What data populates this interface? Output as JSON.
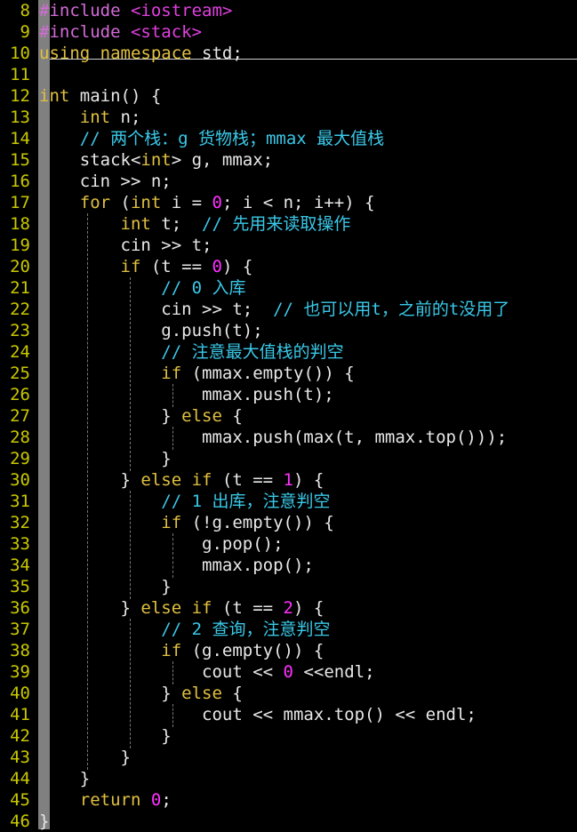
{
  "editor": {
    "line_numbers": [
      "8",
      "9",
      "10",
      "11",
      "12",
      "13",
      "14",
      "15",
      "16",
      "17",
      "18",
      "19",
      "20",
      "21",
      "22",
      "23",
      "24",
      "25",
      "26",
      "27",
      "28",
      "29",
      "30",
      "31",
      "32",
      "33",
      "34",
      "35",
      "36",
      "37",
      "38",
      "39",
      "40",
      "41",
      "42",
      "43",
      "44",
      "45",
      "46"
    ],
    "lines": [
      [
        [
          "pp",
          "#include "
        ],
        [
          "str",
          "<iostream>"
        ]
      ],
      [
        [
          "pp",
          "#include "
        ],
        [
          "str",
          "<stack>"
        ]
      ],
      [
        [
          "kw",
          "using namespace "
        ],
        [
          "tx",
          "std;"
        ]
      ],
      [],
      [
        [
          "kw",
          "int"
        ],
        [
          "tx",
          " main() {"
        ]
      ],
      [
        [
          "tx",
          "    "
        ],
        [
          "kw",
          "int"
        ],
        [
          "tx",
          " n;"
        ]
      ],
      [
        [
          "tx",
          "    "
        ],
        [
          "cm",
          "// 两个栈：g 货物栈；mmax 最大值栈"
        ]
      ],
      [
        [
          "tx",
          "    stack<"
        ],
        [
          "kw",
          "int"
        ],
        [
          "tx",
          "> g, mmax;"
        ]
      ],
      [
        [
          "tx",
          "    cin >> n;"
        ]
      ],
      [
        [
          "tx",
          "    "
        ],
        [
          "kw",
          "for"
        ],
        [
          "tx",
          " ("
        ],
        [
          "kw",
          "int"
        ],
        [
          "tx",
          " i = "
        ],
        [
          "num",
          "0"
        ],
        [
          "tx",
          "; i < n; i++) {"
        ]
      ],
      [
        [
          "tx",
          "        "
        ],
        [
          "kw",
          "int"
        ],
        [
          "tx",
          " t;  "
        ],
        [
          "cm",
          "// 先用来读取操作"
        ]
      ],
      [
        [
          "tx",
          "        cin >> t;"
        ]
      ],
      [
        [
          "tx",
          "        "
        ],
        [
          "kw",
          "if"
        ],
        [
          "tx",
          " (t == "
        ],
        [
          "num",
          "0"
        ],
        [
          "tx",
          ") {"
        ]
      ],
      [
        [
          "tx",
          "            "
        ],
        [
          "cm",
          "// 0 入库"
        ]
      ],
      [
        [
          "tx",
          "            cin >> t;  "
        ],
        [
          "cm",
          "// 也可以用t，之前的t没用了"
        ]
      ],
      [
        [
          "tx",
          "            g.push(t);"
        ]
      ],
      [
        [
          "tx",
          "            "
        ],
        [
          "cm",
          "// 注意最大值栈的判空"
        ]
      ],
      [
        [
          "tx",
          "            "
        ],
        [
          "kw",
          "if"
        ],
        [
          "tx",
          " (mmax.empty()) {"
        ]
      ],
      [
        [
          "tx",
          "                mmax.push(t);"
        ]
      ],
      [
        [
          "tx",
          "            } "
        ],
        [
          "kw",
          "else"
        ],
        [
          "tx",
          " {"
        ]
      ],
      [
        [
          "tx",
          "                mmax.push(max(t, mmax.top()));"
        ]
      ],
      [
        [
          "tx",
          "            }"
        ]
      ],
      [
        [
          "tx",
          "        } "
        ],
        [
          "kw",
          "else if"
        ],
        [
          "tx",
          " (t == "
        ],
        [
          "num",
          "1"
        ],
        [
          "tx",
          ") {"
        ]
      ],
      [
        [
          "tx",
          "            "
        ],
        [
          "cm",
          "// 1 出库，注意判空"
        ]
      ],
      [
        [
          "tx",
          "            "
        ],
        [
          "kw",
          "if"
        ],
        [
          "tx",
          " (!g.empty()) {"
        ]
      ],
      [
        [
          "tx",
          "                g.pop();"
        ]
      ],
      [
        [
          "tx",
          "                mmax.pop();"
        ]
      ],
      [
        [
          "tx",
          "            }"
        ]
      ],
      [
        [
          "tx",
          "        } "
        ],
        [
          "kw",
          "else if"
        ],
        [
          "tx",
          " (t == "
        ],
        [
          "num",
          "2"
        ],
        [
          "tx",
          ") {"
        ]
      ],
      [
        [
          "tx",
          "            "
        ],
        [
          "cm",
          "// 2 查询，注意判空"
        ]
      ],
      [
        [
          "tx",
          "            "
        ],
        [
          "kw",
          "if"
        ],
        [
          "tx",
          " (g.empty()) {"
        ]
      ],
      [
        [
          "tx",
          "                cout << "
        ],
        [
          "num",
          "0"
        ],
        [
          "tx",
          " <<endl;"
        ]
      ],
      [
        [
          "tx",
          "            } "
        ],
        [
          "kw",
          "else"
        ],
        [
          "tx",
          " {"
        ]
      ],
      [
        [
          "tx",
          "                cout << mmax.top() << endl;"
        ]
      ],
      [
        [
          "tx",
          "            }"
        ]
      ],
      [
        [
          "tx",
          "        }"
        ]
      ],
      [
        [
          "tx",
          "    }"
        ]
      ],
      [
        [
          "tx",
          "    "
        ],
        [
          "kw",
          "return"
        ],
        [
          "tx",
          " "
        ],
        [
          "num",
          "0"
        ],
        [
          "tx",
          ";"
        ]
      ],
      [
        [
          "tx",
          "}"
        ]
      ]
    ]
  }
}
